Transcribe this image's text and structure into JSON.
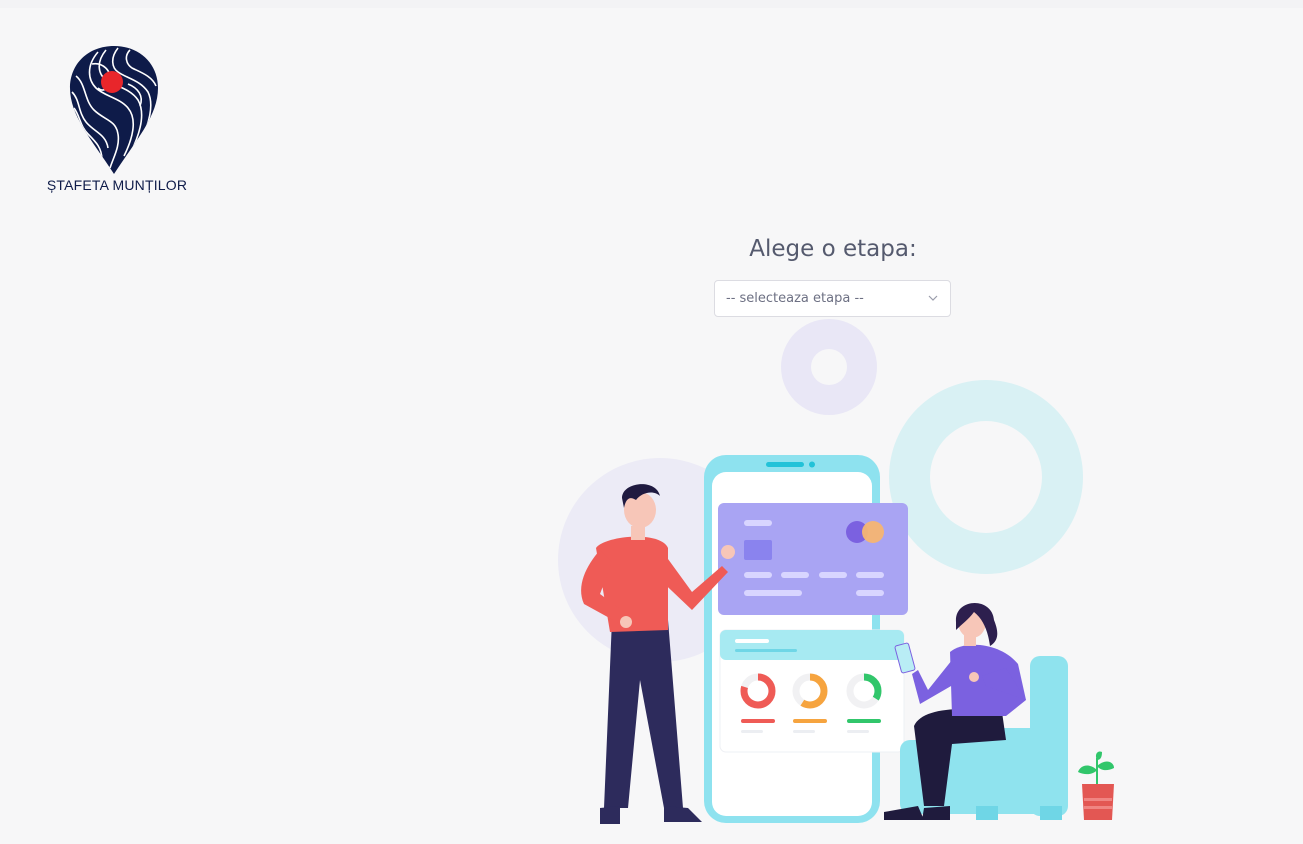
{
  "brand": {
    "name": "ȘTAFETA MUNȚILOR",
    "logo_icon": "map-pin-topographic-icon",
    "colors": {
      "navy": "#0e1b49",
      "red": "#e8262b"
    }
  },
  "stage_picker": {
    "prompt": "Alege o etapa:",
    "selected": "-- selecteaza etapa --"
  },
  "illustration": {
    "icon": "people-mobile-payment-illustration",
    "colors": {
      "phone": "#8ee2ef",
      "card": "#a9a4f3",
      "man_shirt": "#ef5b56",
      "woman_top": "#7b61e0",
      "chair": "#8fe3ee"
    }
  }
}
